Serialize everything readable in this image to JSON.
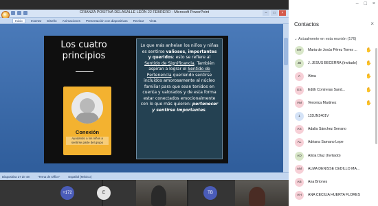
{
  "ppt": {
    "window_title": "CRIANZA POSITIVA DELASALLE LEÓN 22 FEBRERO  -  Microsoft PowerPoint",
    "ribbon_tabs": [
      "Inicio",
      "Insertar",
      "Diseño",
      "Animaciones",
      "Presentación con diapositivas",
      "Revisar",
      "Vista"
    ],
    "status": {
      "slide_count": "Diapositiva 27 de 48",
      "theme": "\"Tema de Office\"",
      "language": "Español (México)"
    },
    "window_controls": [
      "–",
      "□",
      "×"
    ]
  },
  "slide": {
    "title_line1": "Los cuatro",
    "title_line2": "principios",
    "card_title": "Conexión",
    "card_subtitle": "Ayudando a los niños a sentirse parte del grupo",
    "body_p1": "Lo que más anhelan los niños y niñas es sentirse",
    "body_bold1": "valiosos, importantes y queridos",
    "body_p2": ": esto se refiere al",
    "body_u1": "Sentido de Significancia",
    "body_p3": ". También aspiran a lograr el",
    "body_u2": "Sentido de Pertenencia",
    "body_p4": "queriendo sentirse incluidos amorosamente al núcleo familiar para que sean tenidos en cuenta y valorados y de esta forma estar conectados emocionalmente con lo que más quieren:",
    "body_bi": "pertenecer y sentirse importantes",
    "body_p5": "."
  },
  "panel": {
    "window_controls": [
      "–",
      "□",
      "×"
    ],
    "title": "Contactos",
    "close": "×",
    "section": "Actualmente en esta reunión (176)",
    "participants": [
      {
        "initials": "MT",
        "name": "Maria de Jesús Pérez Torres ...",
        "color": "#d9e7c9",
        "hand": true
      },
      {
        "initials": "JB",
        "name": "J. JESUS BECERRA (Invitado)",
        "color": "#d9e7c9",
        "hand": true
      },
      {
        "initials": "A",
        "name": "Alma",
        "color": "#f7d0d7",
        "hand": true
      },
      {
        "initials": "ES",
        "name": "Edith Contreras Sand...",
        "color": "#f7d0d7",
        "hand": true
      },
      {
        "initials": "VM",
        "name": "Veronica Martinez",
        "color": "#f7d0d7",
        "hand": true
      },
      {
        "initials": "1",
        "name": "11DJN2401V",
        "color": "#d5e3f7",
        "hand": false
      },
      {
        "initials": "AS",
        "name": "Adalia Sánchez Serrano",
        "color": "#f7d0d7",
        "hand": false
      },
      {
        "initials": "AL",
        "name": "Adriana Samano Lepe",
        "color": "#f7d0d7",
        "hand": false
      },
      {
        "initials": "AD",
        "name": "Alicia Díaz (Invitado)",
        "color": "#d9e7c9",
        "hand": false
      },
      {
        "initials": "AM",
        "name": "ALMA DENISSE CEDILLO MA...",
        "color": "#f7d0d7",
        "hand": false
      },
      {
        "initials": "AB",
        "name": "Ana Briones",
        "color": "#f7d0d7",
        "hand": false
      },
      {
        "initials": "AH",
        "name": "ANA CECILIA HUERTA FLORES",
        "color": "#f7d0d7",
        "hand": false
      }
    ],
    "hand_icon": "raised-hand-icon"
  },
  "gallery": {
    "tiles": [
      {
        "label": "+172",
        "color": "#4a5cb8"
      },
      {
        "label": "E",
        "color": "#e6e6e6"
      },
      {
        "label": "TB",
        "color": "#4a5cb8"
      }
    ]
  }
}
